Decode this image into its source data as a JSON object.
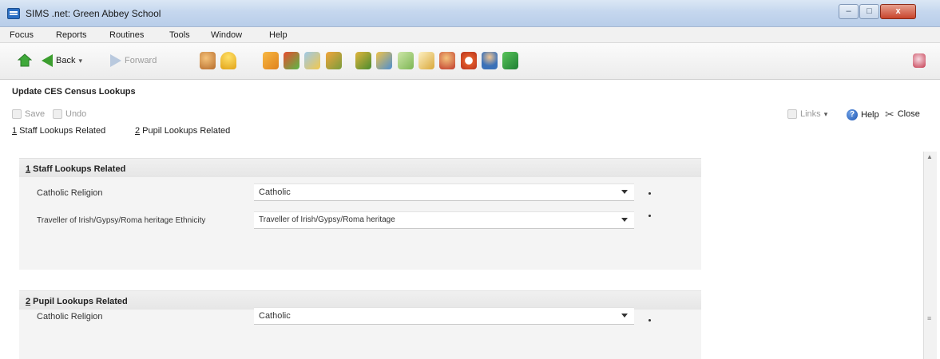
{
  "window": {
    "title": "SIMS .net: Green Abbey School",
    "minimize": "–",
    "maximize": "□",
    "close": "x"
  },
  "menu": [
    "Focus",
    "Reports",
    "Routines",
    "Tools",
    "Window",
    "Help"
  ],
  "toolbar": {
    "back_label": "Back",
    "forward_label": "Forward",
    "icons": [
      "home-icon",
      "people-icon",
      "hint-icon",
      "book-icon",
      "flag-icon",
      "chart-icon",
      "report-icon",
      "books-icon",
      "folder-icon",
      "document-icon",
      "edit-icon",
      "person-icon",
      "clock-icon",
      "user-icon",
      "dollar-icon"
    ]
  },
  "page": {
    "title": "Update CES Census Lookups"
  },
  "commands": {
    "save": "Save",
    "undo": "Undo",
    "links": "Links",
    "help": "Help",
    "close": "Close"
  },
  "tabs": [
    {
      "accel": "1",
      "text": " Staff Lookups Related"
    },
    {
      "accel": "2",
      "text": " Pupil Lookups Related"
    }
  ],
  "sections": {
    "staff": {
      "accel": "1",
      "title": " Staff Lookups Related",
      "rows": [
        {
          "label": "Catholic Religion",
          "value": "Catholic"
        },
        {
          "label": "Traveller of Irish/Gypsy/Roma heritage Ethnicity",
          "value": "Traveller of Irish/Gypsy/Roma heritage"
        }
      ]
    },
    "pupil": {
      "accel": "2",
      "title": " Pupil Lookups Related",
      "rows": [
        {
          "label": "Catholic Religion",
          "value": "Catholic"
        }
      ]
    }
  },
  "colors": {
    "titlebar": "#c5d7ee",
    "accent_green": "#3c9e2f",
    "panel_bg": "#f4f4f4"
  }
}
